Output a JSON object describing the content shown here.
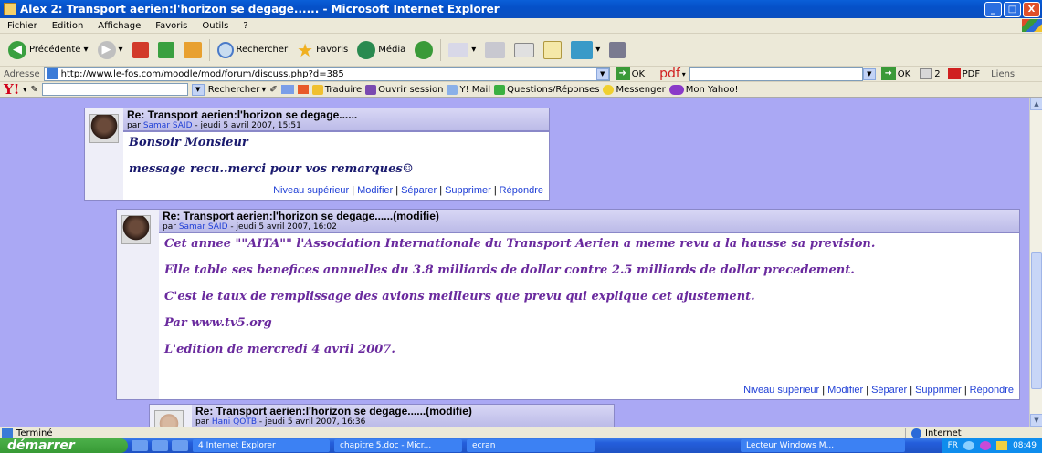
{
  "window": {
    "title": "Alex 2: Transport aerien:l'horizon se degage...... - Microsoft Internet Explorer",
    "controls": [
      "_",
      "□",
      "X"
    ]
  },
  "menu": [
    "Fichier",
    "Edition",
    "Affichage",
    "Favoris",
    "Outils",
    "?"
  ],
  "toolbar": {
    "back": "Précédente",
    "search": "Rechercher",
    "favorites": "Favoris",
    "media": "Média"
  },
  "address": {
    "label": "Adresse",
    "url": "http://www.le-fos.com/moodle/mod/forum/discuss.php?d=385",
    "go": "OK",
    "pdf_label": "pdf",
    "go2": "OK",
    "count": "2",
    "pdf_btn": "PDF",
    "links": "Liens"
  },
  "yahoo": {
    "logo": "Y!",
    "search_btn": "Rechercher",
    "items": [
      "Traduire",
      "Ouvrir session",
      "Y! Mail",
      "Questions/Réponses",
      "Messenger",
      "Mon Yahoo!"
    ]
  },
  "posts": [
    {
      "subject": "Re: Transport aerien:l'horizon se degage......",
      "by_prefix": "par",
      "author": "Samar SAID",
      "date": "- jeudi 5 avril 2007, 15:51",
      "paragraphs": [
        "Bonsoir Monsieur",
        "message recu..merci pour vos remarques☺"
      ],
      "text_color": "#1a1a6e",
      "commands": [
        "Niveau supérieur",
        "Modifier",
        "Séparer",
        "Supprimer",
        "Répondre"
      ]
    },
    {
      "subject": "Re: Transport aerien:l'horizon se degage......(modifie)",
      "by_prefix": "par",
      "author": "Samar SAID",
      "date": "- jeudi 5 avril 2007, 16:02",
      "paragraphs": [
        "Cet annee \"\"AITA\"\" l'Association Internationale du Transport Aerien a meme revu a la hausse sa prevision.",
        "Elle table ses benefices annuelles du 3.8 milliards de dollar contre 2.5 milliards de dollar precedement.",
        "C'est le taux de remplissage des avions meilleurs que prevu qui explique cet ajustement.",
        "Par www.tv5.org",
        "L'edition de mercredi 4 avril 2007."
      ],
      "text_color": "#6a2a9e",
      "commands": [
        "Niveau supérieur",
        "Modifier",
        "Séparer",
        "Supprimer",
        "Répondre"
      ]
    },
    {
      "subject": "Re: Transport aerien:l'horizon se degage......(modifie)",
      "by_prefix": "par",
      "author": "Hani QOTB",
      "date": "- jeudi 5 avril 2007, 16:36"
    }
  ],
  "status": {
    "text": "Terminé",
    "zone": "Internet"
  },
  "taskbar": {
    "start": "démarrer",
    "tasks": [
      "4 Internet Explorer",
      "chapitre 5.doc - Micr...",
      "ecran",
      "Lecteur Windows M..."
    ],
    "lang": "FR",
    "clock": "08:49"
  }
}
